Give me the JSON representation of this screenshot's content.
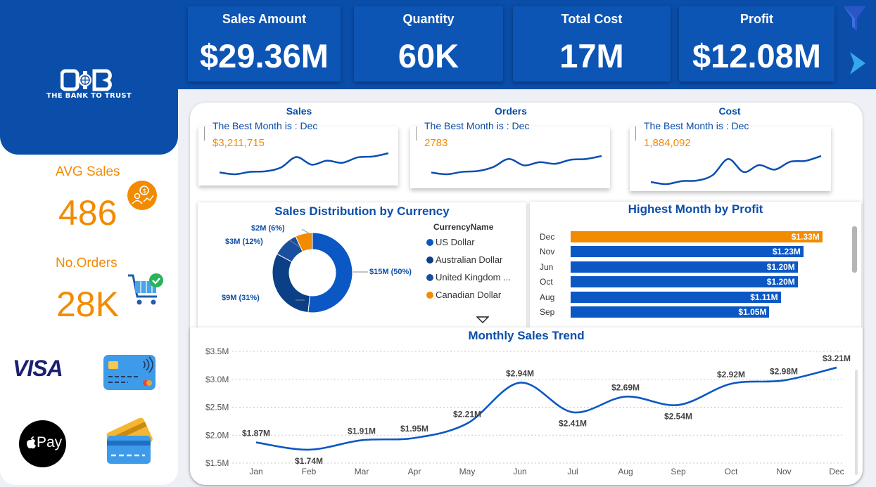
{
  "brand": {
    "tagline": "THE BANK TO TRUST",
    "logo_text": "CIB",
    "primary_color": "#0a4ea9",
    "accent_color": "#f28b00"
  },
  "kpis": [
    {
      "label": "Sales Amount",
      "value": "$29.36M"
    },
    {
      "label": "Quantity",
      "value": "60K"
    },
    {
      "label": "Total Cost",
      "value": "17M"
    },
    {
      "label": "Profit",
      "value": "$12.08M"
    }
  ],
  "side_kpis": {
    "avg_sales_label": "AVG Sales",
    "avg_sales_value": "486",
    "orders_label": "No.Orders",
    "orders_value": "28K"
  },
  "payment_logos": {
    "visa": "VISA",
    "apple_pay": "Pay"
  },
  "sparklines": [
    {
      "title": "Sales",
      "best": "The Best Month is : Dec",
      "value": "$3,211,715"
    },
    {
      "title": "Orders",
      "best": "The Best Month is : Dec",
      "value": "2783"
    },
    {
      "title": "Cost",
      "best": "The Best Month is : Dec",
      "value": "1,884,092"
    }
  ],
  "currency_chart": {
    "title": "Sales Distribution by Currency",
    "legend_title": "CurrencyName",
    "legend": [
      {
        "name": "US Dollar",
        "color": "#0b57c4"
      },
      {
        "name": "Australian Dollar",
        "color": "#0b3f86"
      },
      {
        "name": "United Kingdom ...",
        "color": "#1a4fa0"
      },
      {
        "name": "Canadian Dollar",
        "color": "#f28b00"
      }
    ],
    "labels": [
      "$15M (50%)",
      "$9M (31%)",
      "$3M (12%)",
      "$2M (6%)"
    ]
  },
  "profit_chart": {
    "title": "Highest Month by Profit"
  },
  "trend_chart": {
    "title": "Monthly Sales Trend"
  },
  "chart_data": [
    {
      "type": "pie",
      "title": "Sales Distribution by Currency",
      "categories": [
        "US Dollar",
        "Australian Dollar",
        "United Kingdom ...",
        "Canadian Dollar"
      ],
      "values": [
        15,
        9,
        3,
        2
      ],
      "percent_labels": [
        "$15M (50%)",
        "$9M (31%)",
        "$3M (12%)",
        "$2M (6%)"
      ],
      "colors": [
        "#0b57c4",
        "#0b3f86",
        "#1a4fa0",
        "#f28b00"
      ],
      "legend_position": "right"
    },
    {
      "type": "bar",
      "title": "Highest Month by Profit",
      "orientation": "horizontal",
      "categories": [
        "Dec",
        "Nov",
        "Jun",
        "Oct",
        "Aug",
        "Sep"
      ],
      "values": [
        1.33,
        1.23,
        1.2,
        1.2,
        1.11,
        1.05
      ],
      "value_labels": [
        "$1.33M",
        "$1.23M",
        "$1.20M",
        "$1.20M",
        "$1.11M",
        "$1.05M"
      ],
      "highlight_color": "#f28b00",
      "bar_color": "#0b57c4",
      "xlim": [
        0,
        1.42
      ]
    },
    {
      "type": "line",
      "title": "Monthly Sales Trend",
      "x": [
        "Jan",
        "Feb",
        "Mar",
        "Apr",
        "May",
        "Jun",
        "Jul",
        "Aug",
        "Sep",
        "Oct",
        "Nov",
        "Dec"
      ],
      "values": [
        1.87,
        1.74,
        1.91,
        1.95,
        2.21,
        2.94,
        2.41,
        2.69,
        2.54,
        2.92,
        2.98,
        3.21
      ],
      "value_labels": [
        "$1.87M",
        "$1.74M",
        "$1.91M",
        "$1.95M",
        "$2.21M",
        "$2.94M",
        "$2.41M",
        "$2.69M",
        "$2.54M",
        "$2.92M",
        "$2.98M",
        "$3.21M"
      ],
      "yticks": [
        "$1.5M",
        "$2.0M",
        "$2.5M",
        "$3.0M",
        "$3.5M"
      ],
      "ylim": [
        1.5,
        3.5
      ],
      "grid": true,
      "color": "#0b57c4"
    },
    {
      "type": "line",
      "title": "Sales",
      "values": [
        1.87,
        1.74,
        1.91,
        1.95,
        2.21,
        2.94,
        2.41,
        2.69,
        2.54,
        2.92,
        2.98,
        3.21
      ]
    },
    {
      "type": "line",
      "title": "Orders",
      "values": [
        1760,
        1650,
        1800,
        1850,
        2100,
        2600,
        2200,
        2400,
        2300,
        2550,
        2600,
        2783
      ]
    },
    {
      "type": "line",
      "title": "Cost",
      "values": [
        1.02,
        0.95,
        1.05,
        1.07,
        1.25,
        1.78,
        1.35,
        1.58,
        1.43,
        1.69,
        1.72,
        1.88
      ]
    }
  ]
}
